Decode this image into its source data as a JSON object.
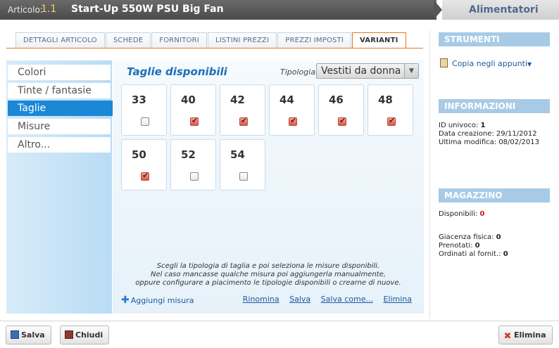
{
  "header": {
    "article_label": "Articolo:",
    "article_number": "1.1",
    "article_title": "Start-Up 550W PSU Big Fan",
    "section": "Alimentatori"
  },
  "tabs": [
    {
      "label": "DETTAGLI ARTICOLO"
    },
    {
      "label": "SCHEDE"
    },
    {
      "label": "FORNITORI"
    },
    {
      "label": "LISTINI PREZZI"
    },
    {
      "label": "PREZZI IMPOSTI"
    },
    {
      "label": "VARIANTI"
    }
  ],
  "categories": [
    {
      "label": "Colori"
    },
    {
      "label": "Tinte / fantasie"
    },
    {
      "label": "Taglie"
    },
    {
      "label": "Misure"
    },
    {
      "label": "Altro..."
    }
  ],
  "main": {
    "title": "Taglie disponibili",
    "tipologia_label": "Tipologia:",
    "tipologia_value": "Vestiti da donna",
    "sizes": [
      {
        "label": "33",
        "checked": false
      },
      {
        "label": "40",
        "checked": true
      },
      {
        "label": "42",
        "checked": true
      },
      {
        "label": "44",
        "checked": true
      },
      {
        "label": "46",
        "checked": true
      },
      {
        "label": "48",
        "checked": true
      },
      {
        "label": "50",
        "checked": true
      },
      {
        "label": "52",
        "checked": false
      },
      {
        "label": "54",
        "checked": false
      }
    ],
    "hint_lines": [
      "Scegli la tipologia di taglia e poi seleziona le misure disponibili.",
      "Nel caso mancasse qualche misura poi aggiungerla manualmente,",
      "oppure configurare a piacimento le tipologie disponibili o crearne di nuove."
    ],
    "add_label": "Aggiungi misura",
    "links": {
      "rename": "Rinomina",
      "save": "Salva",
      "save_as": "Salva come...",
      "delete": "Elimina"
    }
  },
  "right": {
    "strumenti": "STRUMENTI",
    "copy_label": "Copia negli appunti",
    "informazioni": "INFORMAZIONI",
    "id_label": "ID univoco:",
    "id_value": "1",
    "created_label": "Data creazione:",
    "created_value": "29/11/2012",
    "modified_label": "Ultima modifica:",
    "modified_value": "08/02/2013",
    "magazzino": "MAGAZZINO",
    "available_label": "Disponibili:",
    "available_value": "0",
    "stock_label": "Giacenza fisica:",
    "stock_value": "0",
    "booked_label": "Prenotati:",
    "booked_value": "0",
    "ordered_label": "Ordinati al fornit.:",
    "ordered_value": "0"
  },
  "footer": {
    "save": "Salva",
    "close": "Chiudi",
    "delete": "Elimina"
  },
  "colors": {
    "accent": "#1b88d6",
    "tab_active_border": "#e07a20",
    "header_dark": "#555555"
  }
}
